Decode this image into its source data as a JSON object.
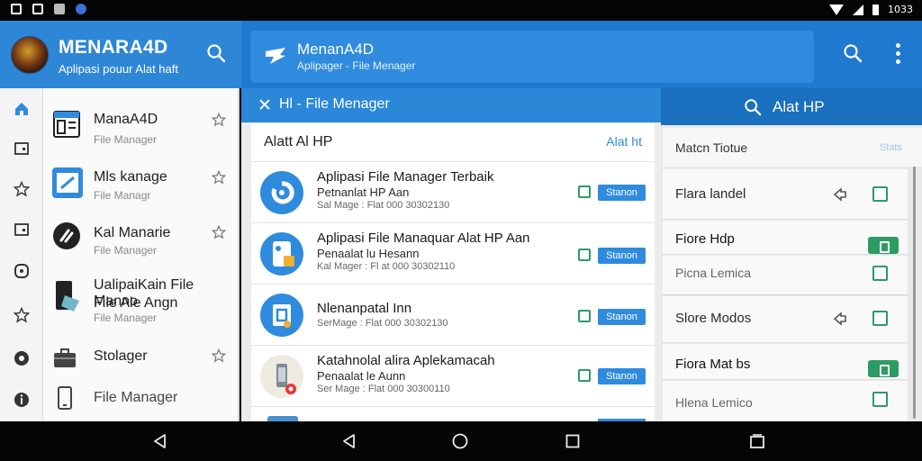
{
  "status_bar": {
    "left_icons": [
      "notification-icon",
      "notification-icon",
      "image-icon",
      "app-icon"
    ],
    "right_icons": [
      "wifi-icon",
      "signal-icon",
      "battery-icon"
    ],
    "time": "1033"
  },
  "app_header": {
    "title": "MENARA4D",
    "subtitle": "Aplipasi pouur Alat haft"
  },
  "main_header": {
    "title": "MenanA4D",
    "subtitle": "Aplipager - File Menager"
  },
  "rail_icons": [
    "home-icon",
    "folder-icon",
    "star-icon",
    "folder-icon",
    "clock-icon",
    "star-icon",
    "settings-icon",
    "info-icon"
  ],
  "drawer": {
    "items": [
      {
        "title": "ManaA4D",
        "subtitle": "File Manager",
        "icon": "file-manager-icon"
      },
      {
        "title": "Mls kanage",
        "subtitle": "File Managr",
        "icon": "edit-icon"
      },
      {
        "title": "Kal Manarie",
        "subtitle": "File Manager",
        "icon": "tools-icon"
      },
      {
        "title": "UalipaiKain File Manno",
        "title2": "File Ale Angn",
        "subtitle": "File Manager",
        "icon": "phone-icon"
      },
      {
        "title": "Stolager",
        "subtitle": "",
        "icon": "briefcase-icon"
      },
      {
        "title": "File Manager",
        "subtitle": "",
        "icon": "device-icon"
      }
    ]
  },
  "center_panel": {
    "header_title": "Hl - File Menager",
    "header_close": "✕",
    "section_title": "Alatt Al HP",
    "section_link": "Alat ht",
    "rows": [
      {
        "title": "Aplipasi File Manager Terbaik",
        "subtitle": "Petnanlat HP Aan",
        "meta": "Sal Mage : Flat 000 30302130",
        "button": "Stanon"
      },
      {
        "title": "Aplipasi File Manaquar Alat HP Aan",
        "subtitle": "Penaalat lu Hesann",
        "meta": "Kal Mager : Fl at 000 30302110",
        "button": "Stanon"
      },
      {
        "title": "Nlenanpatal Inn",
        "subtitle": "",
        "meta": "SerMage : Flat 000 30302130",
        "button": "Stanon"
      },
      {
        "title": "Katahnolal alira Aplekamacah",
        "subtitle": "Penaalat le Aunn",
        "meta": "Ser Mage : Flat 000 30300110",
        "button": "Stanon"
      }
    ]
  },
  "right_panel": {
    "search_title": "Alat HP",
    "sub_title": "Matcn Tiotue",
    "sub_link": "Stats",
    "items": [
      {
        "title": "Flara landel",
        "control": "checkbox",
        "arrow": true
      },
      {
        "title": "Fiore Hdp",
        "control": "badge",
        "arrow": false
      },
      {
        "title": "Picna Lemica",
        "control": "checkbox",
        "arrow": false
      },
      {
        "title": "Slore Modos",
        "control": "checkbox",
        "arrow": true
      },
      {
        "title": "Fiora Mat bs",
        "control": "badge",
        "arrow": false
      },
      {
        "title": "Hlena Lemico",
        "control": "checkbox",
        "arrow": false
      }
    ]
  },
  "nav_bar": [
    "back-icon",
    "back-icon",
    "home-icon",
    "recents-icon",
    "recents-icon"
  ],
  "colors": {
    "primary": "#2e86d6",
    "primary_dark": "#1a6fbf",
    "accent_green": "#2d9b62"
  }
}
